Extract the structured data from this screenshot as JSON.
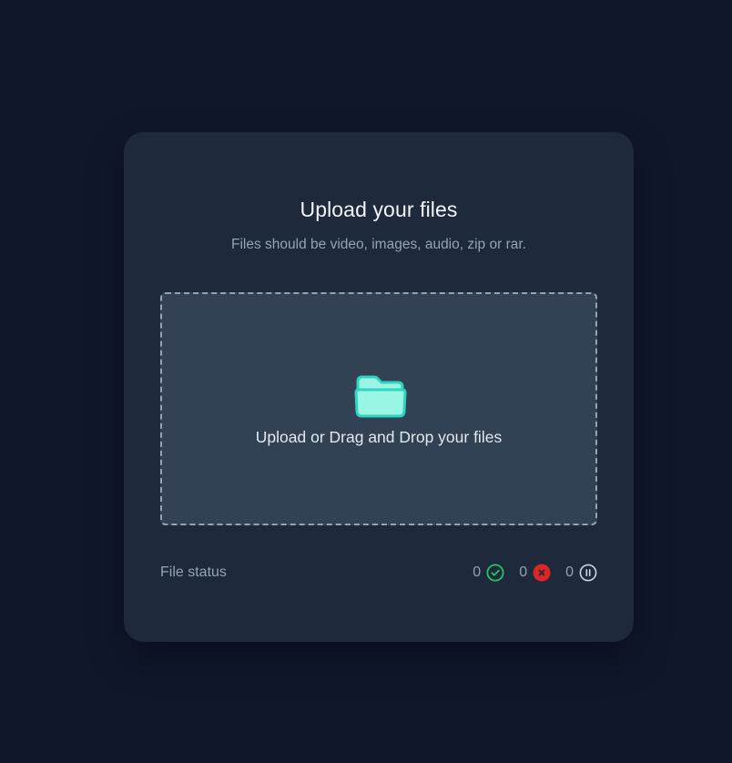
{
  "upload": {
    "title": "Upload your files",
    "subtitle": "Files should be video, images, audio, zip or rar.",
    "dropzone_label": "Upload or Drag and Drop your files",
    "dropzone_icon": "folder-icon"
  },
  "file_status": {
    "label": "File status",
    "success_count": "0",
    "error_count": "0",
    "paused_count": "0",
    "success_icon": "check-circle-icon",
    "error_icon": "x-circle-icon",
    "paused_icon": "pause-circle-icon"
  },
  "colors": {
    "background": "#0f172a",
    "card": "#1e293b",
    "dropzone": "#334155",
    "accent": "#2dd4bf",
    "success": "#22c55e",
    "error": "#dc2626"
  }
}
